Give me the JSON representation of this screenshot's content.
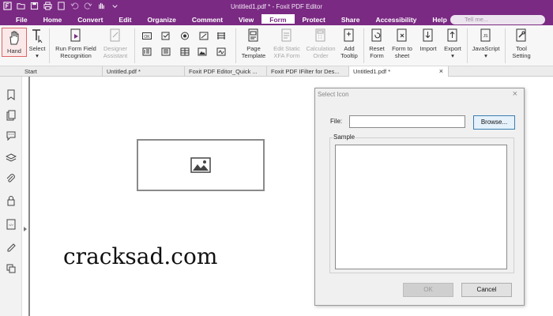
{
  "window": {
    "title": "Untitled1.pdf * - Foxit PDF Editor"
  },
  "ribbon_tabs": [
    "File",
    "Home",
    "Convert",
    "Edit",
    "Organize",
    "Comment",
    "View",
    "Form",
    "Protect",
    "Share",
    "Accessibility",
    "Help"
  ],
  "active_tab": "Form",
  "tell_me": {
    "placeholder": "Tell me..."
  },
  "ribbon": {
    "hand": "Hand",
    "select": "Select",
    "run_form_1": "Run Form Field",
    "run_form_2": "Recognition",
    "designer_1": "Designer",
    "designer_2": "Assistant",
    "page_template_1": "Page",
    "page_template_2": "Template",
    "edit_static_1": "Edit Static",
    "edit_static_2": "XFA Form",
    "calc_order_1": "Calculation",
    "calc_order_2": "Order",
    "add_tooltip_1": "Add",
    "add_tooltip_2": "Tooltip",
    "reset_form_1": "Reset",
    "reset_form_2": "Form",
    "form_to_sheet_1": "Form to",
    "form_to_sheet_2": "sheet",
    "import": "Import",
    "export": "Export",
    "javascript": "JavaScript",
    "tool_settings_1": "Tool",
    "tool_settings_2": "Setting",
    "ok_field_icon_text": "OK"
  },
  "doc_tabs": [
    {
      "label": "Start"
    },
    {
      "label": "Untitled.pdf *"
    },
    {
      "label": "Foxit PDF Editor_Quick ..."
    },
    {
      "label": "Foxit PDF IFilter for Des..."
    },
    {
      "label": "Untitled1.pdf *",
      "active": true
    }
  ],
  "watermark": "cracksad.com",
  "dialog": {
    "title": "Select Icon",
    "file_label": "File:",
    "file_value": "",
    "browse": "Browse...",
    "sample_label": "Sample",
    "ok": "OK",
    "cancel": "Cancel"
  },
  "colors": {
    "brand": "#7a2a83",
    "ribbon_bg": "#f7f7f7",
    "dialog_bg": "#f0f0f0"
  }
}
